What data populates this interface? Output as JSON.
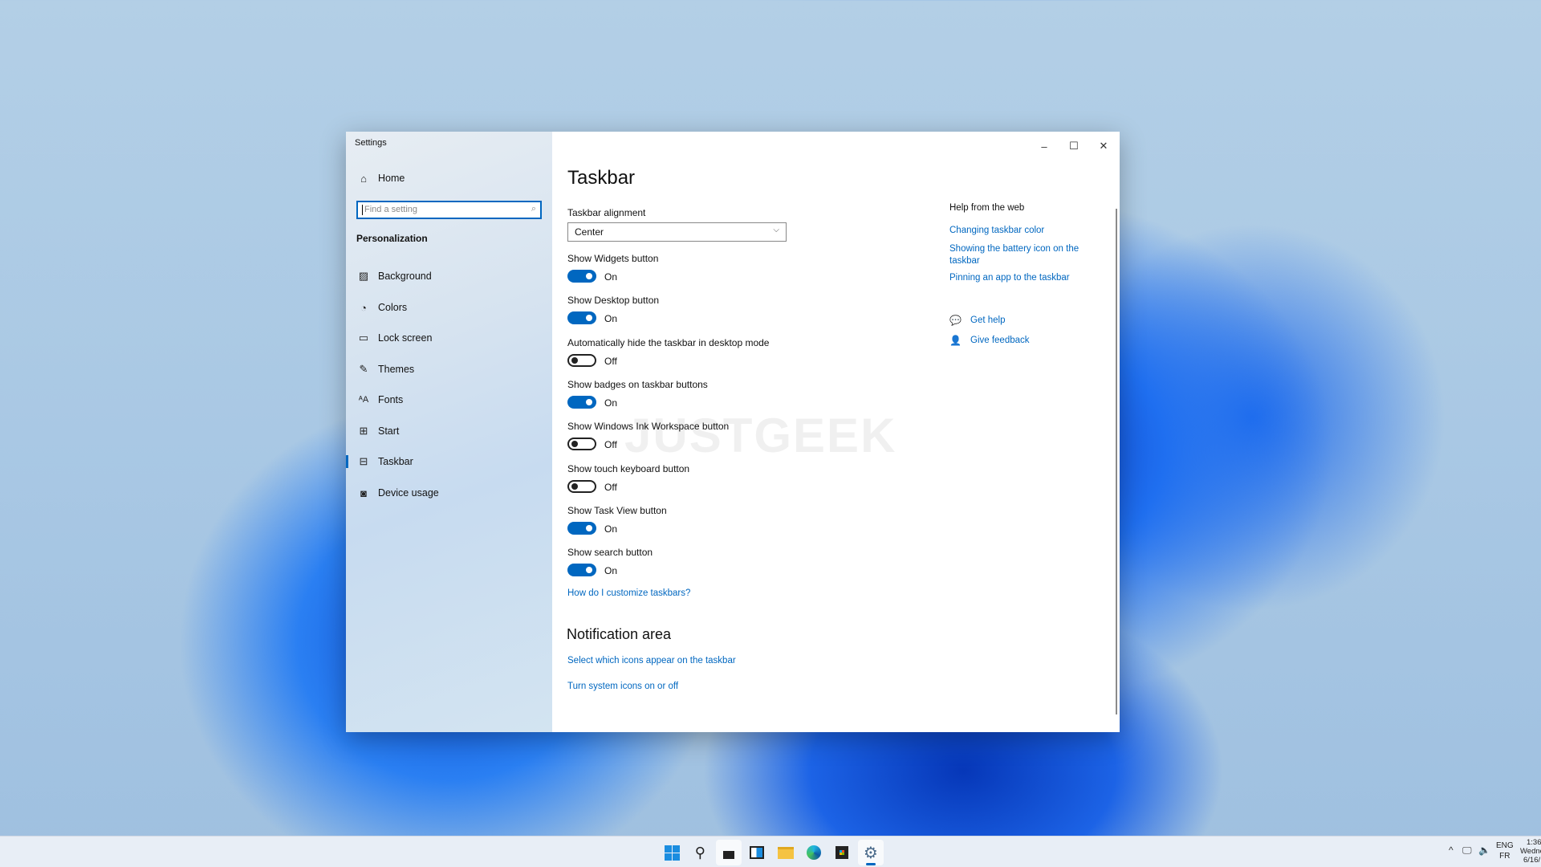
{
  "window": {
    "title": "Settings",
    "minimize_icon": "minimize-icon",
    "maximize_icon": "maximize-icon",
    "close_icon": "close-icon"
  },
  "sidebar": {
    "home": "Home",
    "search_placeholder": "Find a setting",
    "section": "Personalization",
    "items": [
      {
        "label": "Background",
        "icon": "image-icon"
      },
      {
        "label": "Colors",
        "icon": "palette-icon"
      },
      {
        "label": "Lock screen",
        "icon": "lock-screen-icon"
      },
      {
        "label": "Themes",
        "icon": "brush-icon"
      },
      {
        "label": "Fonts",
        "icon": "fonts-icon"
      },
      {
        "label": "Start",
        "icon": "start-icon"
      },
      {
        "label": "Taskbar",
        "icon": "taskbar-icon",
        "selected": true
      },
      {
        "label": "Device usage",
        "icon": "device-usage-icon"
      }
    ]
  },
  "main": {
    "title": "Taskbar",
    "alignment_label": "Taskbar alignment",
    "alignment_value": "Center",
    "toggles": [
      {
        "label": "Show Widgets button",
        "state": "On"
      },
      {
        "label": "Show Desktop button",
        "state": "On"
      },
      {
        "label": "Automatically hide the taskbar in desktop mode",
        "state": "Off"
      },
      {
        "label": "Show badges on taskbar buttons",
        "state": "On"
      },
      {
        "label": "Show Windows Ink Workspace button",
        "state": "Off"
      },
      {
        "label": "Show touch keyboard button",
        "state": "Off"
      },
      {
        "label": "Show Task View button",
        "state": "On"
      },
      {
        "label": "Show search button",
        "state": "On"
      }
    ],
    "customize_link": "How do I customize taskbars?",
    "notification_heading": "Notification area",
    "notification_links": [
      "Select which icons appear on the taskbar",
      "Turn system icons on or off"
    ]
  },
  "help": {
    "heading": "Help from the web",
    "links": [
      "Changing taskbar color",
      "Showing the battery icon on the taskbar",
      "Pinning an app to the taskbar"
    ],
    "get_help": "Get help",
    "feedback": "Give feedback"
  },
  "watermark": "JUSTGEEK",
  "taskbar": {
    "apps": [
      "start",
      "search",
      "desktop",
      "widgets",
      "file-explorer",
      "edge",
      "store",
      "settings"
    ],
    "lang_top": "ENG",
    "lang_bottom": "FR",
    "time": "1:36",
    "date_line1": "Wedne",
    "date_line2": "6/16/"
  },
  "colors": {
    "accent": "#0067c0"
  }
}
